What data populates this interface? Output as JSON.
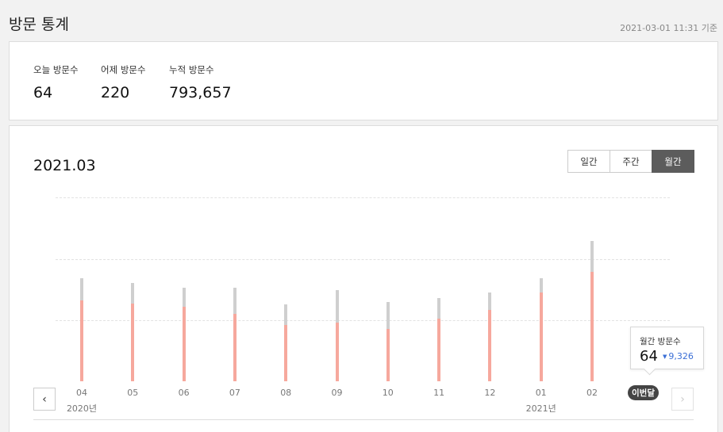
{
  "header": {
    "title": "방문 통계",
    "updated": "2021-03-01 11:31 기준"
  },
  "summary": {
    "today": {
      "label": "오늘 방문수",
      "value": "64"
    },
    "yesterday": {
      "label": "어제 방문수",
      "value": "220"
    },
    "total": {
      "label": "누적 방문수",
      "value": "793,657"
    }
  },
  "chart_section": {
    "title": "2021.03",
    "tabs": [
      {
        "label": "일간",
        "active": false
      },
      {
        "label": "주간",
        "active": false
      },
      {
        "label": "월간",
        "active": true
      }
    ],
    "current_label": "이번달",
    "tooltip": {
      "label": "월간 방문수",
      "value": "64",
      "change": "9,326",
      "change_direction": "down",
      "change_color": "#3b6fd6"
    }
  },
  "chart_data": {
    "type": "bar",
    "categories": [
      "04",
      "05",
      "06",
      "07",
      "08",
      "09",
      "10",
      "11",
      "12",
      "01",
      "02",
      "이번달"
    ],
    "years": [
      {
        "label": "2020년",
        "at": "04"
      },
      {
        "label": "2021년",
        "at": "01"
      }
    ],
    "series": [
      {
        "values": [
          8100,
          7800,
          7500,
          6800,
          5700,
          5900,
          5300,
          6300,
          7200,
          8900,
          11000,
          64
        ],
        "color": "#f6a89d"
      },
      {
        "values": [
          10400,
          9900,
          9400,
          9400,
          7700,
          9200,
          8000,
          8400,
          8900,
          10400,
          14100,
          64
        ],
        "color": "#cfcfcf"
      }
    ],
    "ylim": [
      0,
      18500
    ],
    "grid": true,
    "legend": "none"
  }
}
